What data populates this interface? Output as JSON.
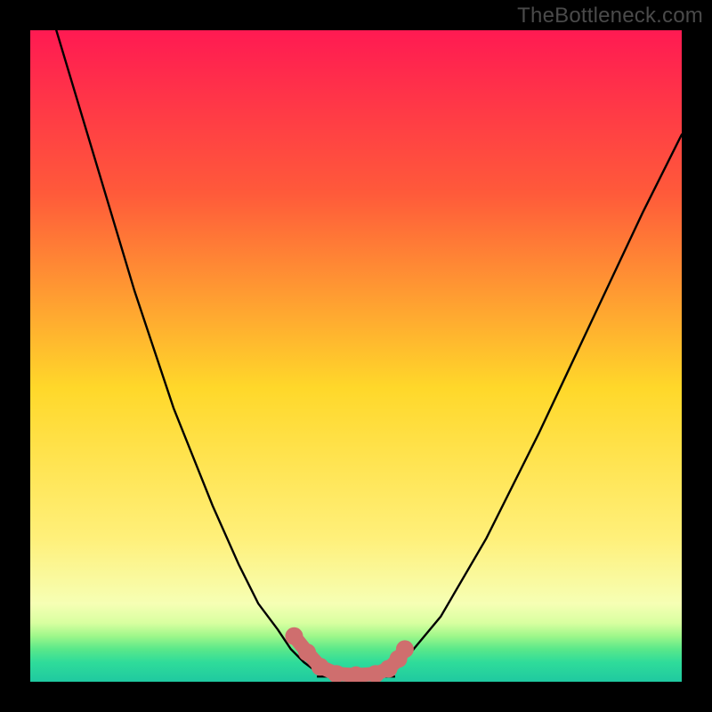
{
  "watermark": {
    "text": "TheBottleneck.com"
  },
  "colors": {
    "background": "#000000",
    "curve": "#000000",
    "marker_fill": "#cf6e6e",
    "marker_stroke": "#b85a5a"
  },
  "chart_data": {
    "type": "line",
    "title": "",
    "xlabel": "",
    "ylabel": "",
    "xlim": [
      0,
      100
    ],
    "ylim": [
      0,
      100
    ],
    "curve_left": {
      "name": "descent",
      "x": [
        4,
        10,
        16,
        22,
        28,
        32,
        35,
        38,
        40,
        42,
        44,
        46
      ],
      "y": [
        100,
        80,
        60,
        42,
        27,
        18,
        12,
        8,
        5,
        3,
        1.5,
        1
      ]
    },
    "curve_right": {
      "name": "ascent",
      "x": [
        54,
        58,
        63,
        70,
        78,
        86,
        94,
        100
      ],
      "y": [
        1,
        4,
        10,
        22,
        38,
        55,
        72,
        84
      ]
    },
    "floor_segment": {
      "x": [
        44,
        56
      ],
      "y": [
        0.8,
        0.8
      ]
    },
    "markers": {
      "name": "highlighted-points",
      "x": [
        40.5,
        42.5,
        44.5,
        47,
        50,
        53,
        55,
        56.5,
        57.5
      ],
      "y": [
        7,
        4.5,
        2.3,
        1.2,
        1,
        1.2,
        2,
        3.5,
        5
      ]
    }
  }
}
